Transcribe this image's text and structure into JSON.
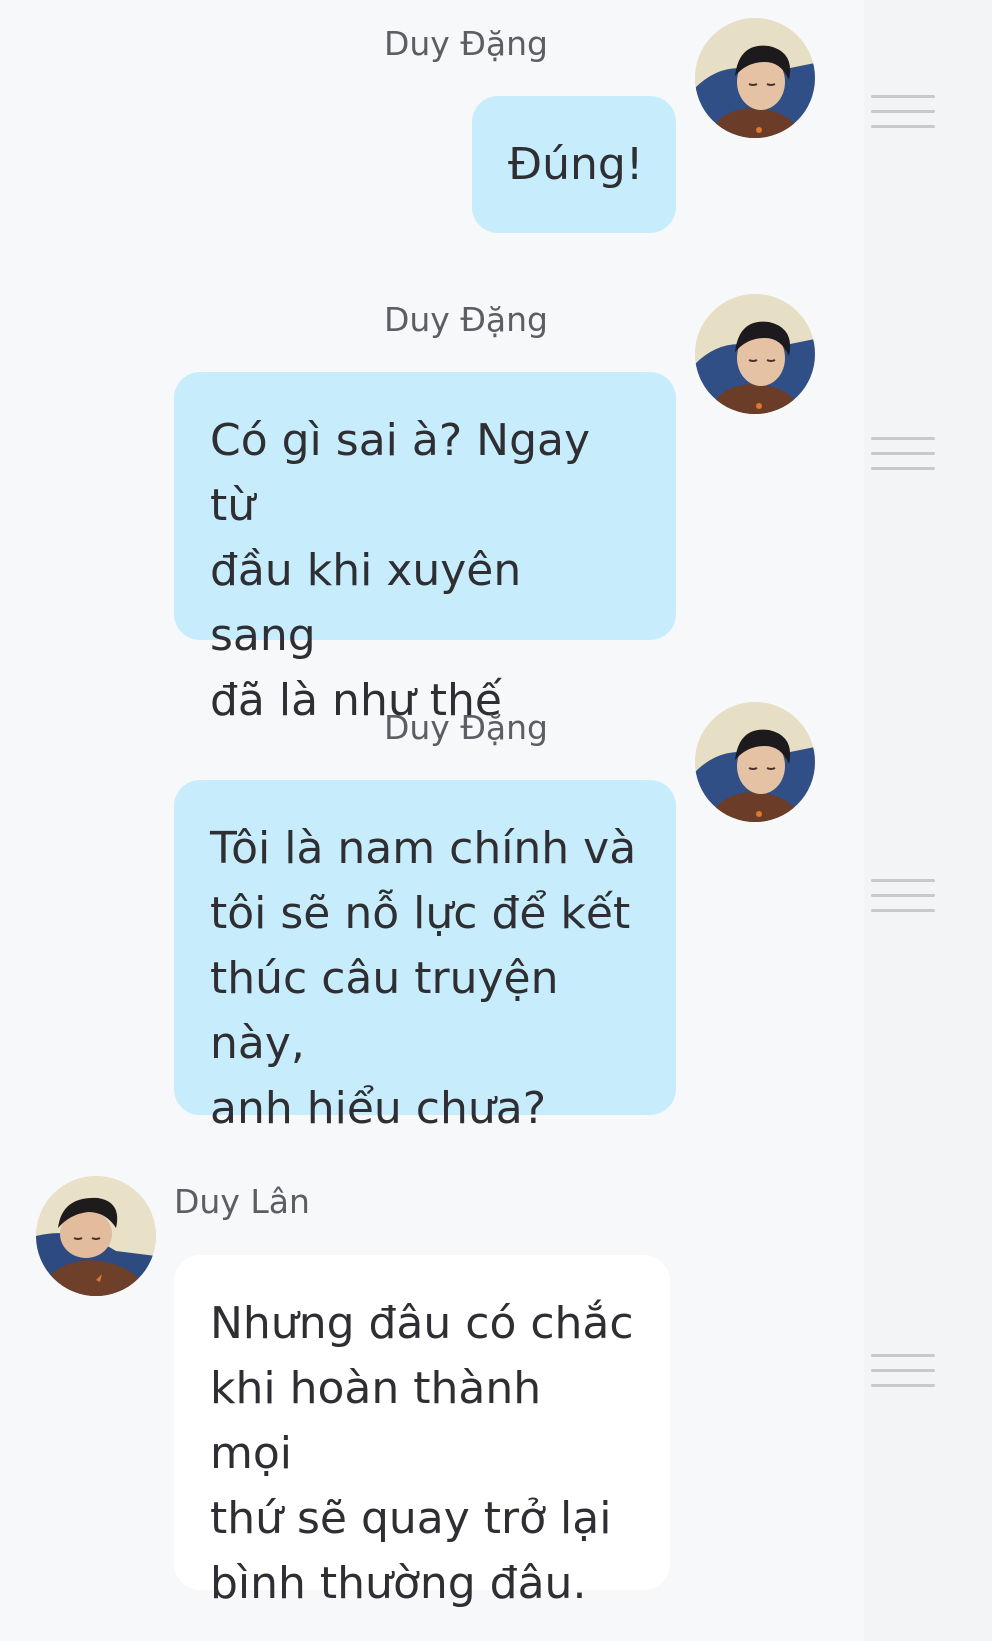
{
  "colors": {
    "outgoing_bubble": "#c7edfd",
    "incoming_bubble": "#ffffff",
    "background": "#f7f8fa",
    "text": "#2f2f33",
    "name": "#5d5d63"
  },
  "messages": [
    {
      "sender": "Duy Đặng",
      "direction": "outgoing",
      "avatar_icon": "avatar-duy-dang",
      "text": "Đúng!"
    },
    {
      "sender": "Duy Đặng",
      "direction": "outgoing",
      "avatar_icon": "avatar-duy-dang",
      "text": "Có gì sai à? Ngay từ\nđầu khi xuyên sang\nđã là như thế"
    },
    {
      "sender": "Duy Đặng",
      "direction": "outgoing",
      "avatar_icon": "avatar-duy-dang",
      "text": "Tôi là nam chính và\ntôi sẽ nỗ lực để kết\nthúc câu truyện này,\nanh hiểu chưa?"
    },
    {
      "sender": "Duy Lân",
      "direction": "incoming",
      "avatar_icon": "avatar-duy-lan",
      "text": "Nhưng đâu có chắc\nkhi hoàn thành mọi\nthứ sẽ quay trở lại\nbình thường đâu."
    }
  ]
}
